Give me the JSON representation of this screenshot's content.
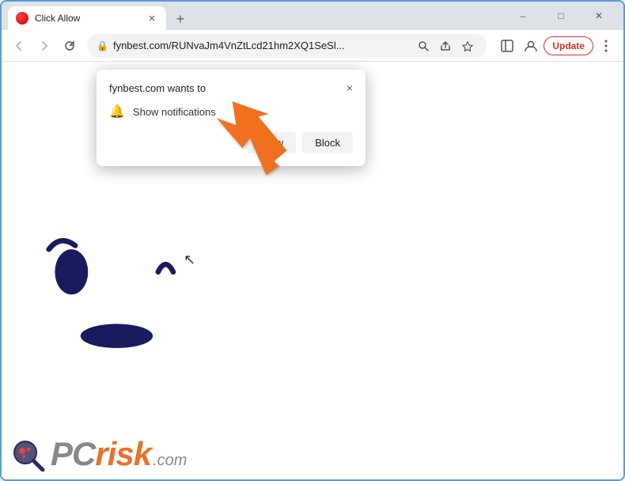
{
  "window": {
    "title": "Click Allow",
    "tab": {
      "label": "Click Allow",
      "favicon": "red-circle"
    },
    "controls": {
      "minimize": "–",
      "maximize": "□",
      "close": "✕"
    }
  },
  "nav": {
    "back_label": "←",
    "forward_label": "→",
    "reload_label": "✕",
    "url": "fynbest.com/RUNvaJm4VnZtLcd21hm2XQ1SeSl...",
    "update_label": "Update"
  },
  "dialog": {
    "title": "fynbest.com wants to",
    "close_label": "×",
    "option_label": "Show notifications",
    "allow_label": "Allow",
    "block_label": "Block"
  },
  "arrow": {
    "color": "#f07020",
    "pointing_to": "allow-button"
  },
  "watermark": {
    "pc_text": "PC",
    "risk_text": "risk",
    "domain": ".com"
  },
  "icons": {
    "lock": "🔒",
    "search": "🔍",
    "share": "↗",
    "star": "☆",
    "sidebar": "▣",
    "profile": "👤",
    "more": "⋮",
    "new_tab": "+",
    "bell": "🔔"
  }
}
